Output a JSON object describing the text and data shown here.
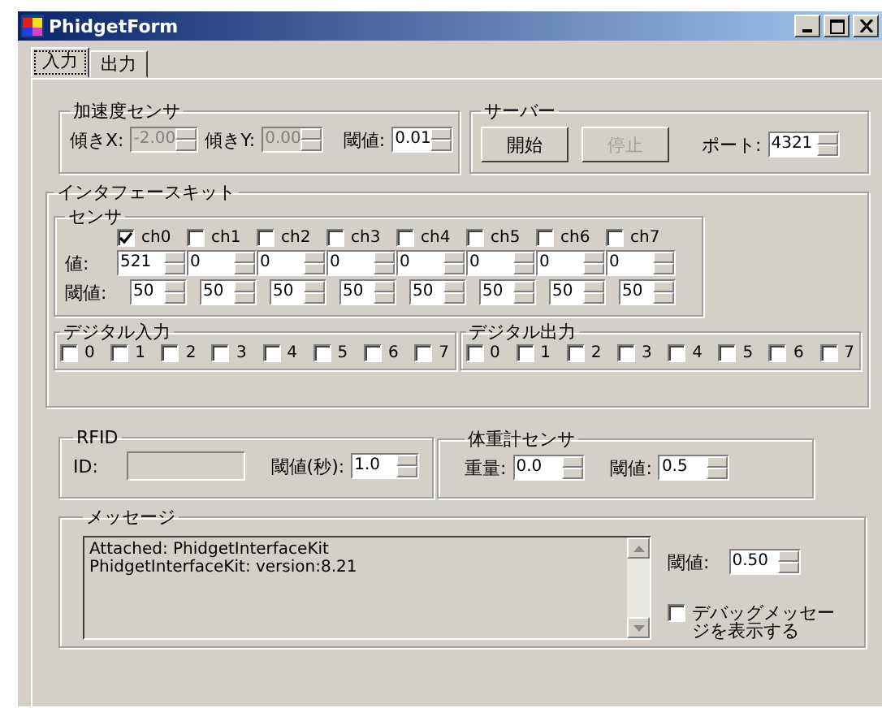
{
  "window": {
    "title": "PhidgetForm"
  },
  "tabs": [
    {
      "label": "入力",
      "selected": true
    },
    {
      "label": "出力",
      "selected": false
    }
  ],
  "accel": {
    "title": "加速度センサ",
    "fields": [
      {
        "label": "傾きX:",
        "value": "-2.00",
        "disabled": true
      },
      {
        "label": "傾きY:",
        "value": "0.00",
        "disabled": true
      },
      {
        "label": "閾値:",
        "value": "0.01",
        "disabled": false
      }
    ]
  },
  "server": {
    "title": "サーバー",
    "buttons": [
      {
        "label": "開始",
        "disabled": false
      },
      {
        "label": "停止",
        "disabled": true
      }
    ],
    "port_label": "ポート:",
    "port": "4321"
  },
  "interface_kit": {
    "title": "インタフェースキット",
    "sensor": {
      "title": "センサ",
      "value_label": "値:",
      "threshold_label": "閾値:",
      "channels": [
        {
          "label": "ch0",
          "checked": true,
          "value": "521",
          "threshold": "50"
        },
        {
          "label": "ch1",
          "checked": false,
          "value": "0",
          "threshold": "50"
        },
        {
          "label": "ch2",
          "checked": false,
          "value": "0",
          "threshold": "50"
        },
        {
          "label": "ch3",
          "checked": false,
          "value": "0",
          "threshold": "50"
        },
        {
          "label": "ch4",
          "checked": false,
          "value": "0",
          "threshold": "50"
        },
        {
          "label": "ch5",
          "checked": false,
          "value": "0",
          "threshold": "50"
        },
        {
          "label": "ch6",
          "checked": false,
          "value": "0",
          "threshold": "50"
        },
        {
          "label": "ch7",
          "checked": false,
          "value": "0",
          "threshold": "50"
        }
      ]
    },
    "digital_in": {
      "title": "デジタル入力",
      "items": [
        {
          "label": "0",
          "checked": false
        },
        {
          "label": "1",
          "checked": false
        },
        {
          "label": "2",
          "checked": false
        },
        {
          "label": "3",
          "checked": false
        },
        {
          "label": "4",
          "checked": false
        },
        {
          "label": "5",
          "checked": false
        },
        {
          "label": "6",
          "checked": false
        },
        {
          "label": "7",
          "checked": false
        }
      ]
    },
    "digital_out": {
      "title": "デジタル出力",
      "items": [
        {
          "label": "0",
          "checked": false
        },
        {
          "label": "1",
          "checked": false
        },
        {
          "label": "2",
          "checked": false
        },
        {
          "label": "3",
          "checked": false
        },
        {
          "label": "4",
          "checked": false
        },
        {
          "label": "5",
          "checked": false
        },
        {
          "label": "6",
          "checked": false
        },
        {
          "label": "7",
          "checked": false
        }
      ]
    }
  },
  "rfid": {
    "title": "RFID",
    "id_label": "ID:",
    "threshold_label": "閾値(秒):",
    "threshold": "1.0"
  },
  "weight": {
    "title": "体重計センサ",
    "weight_label": "重量:",
    "weight": "0.0",
    "threshold_label": "閾値:",
    "threshold": "0.5"
  },
  "message": {
    "title": "メッセージ",
    "lines": [
      "Attached: PhidgetInterfaceKit",
      "PhidgetInterfaceKit: version:8.21"
    ],
    "threshold_label": "閾値:",
    "threshold": "0.50",
    "debug": {
      "label": "デバッグメッセージを表示する",
      "checked": false
    }
  }
}
